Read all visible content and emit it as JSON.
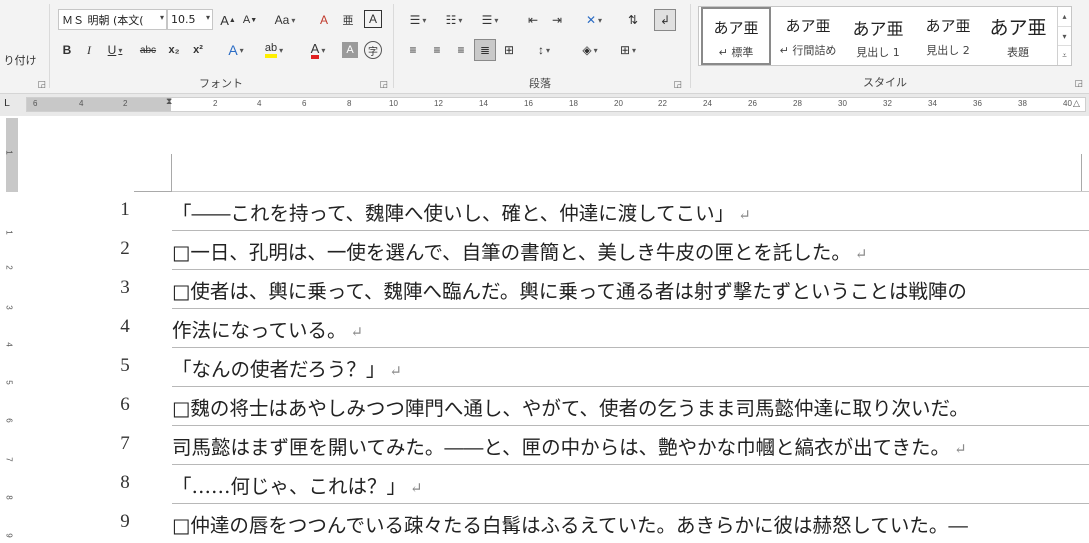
{
  "ribbon": {
    "clipboard": {
      "paste_fragment": "り付け"
    },
    "font": {
      "font_name": "ＭＳ 明朝 (本文(",
      "font_size": "10.5",
      "grow_label": "A",
      "shrink_label": "A",
      "case_label": "Aa",
      "clear_label": "A",
      "phonetic_label": "亜",
      "border_char_label": "A",
      "bold_label": "B",
      "italic_label": "I",
      "underline_label": "U",
      "strike_label": "abc",
      "sub_label": "x₂",
      "sup_label": "x²",
      "effects_label": "A",
      "highlight_label": "ab",
      "color_label": "A",
      "shade_label": "A",
      "enclose_label": "字",
      "group_label": "フォント"
    },
    "paragraph": {
      "group_label": "段落"
    },
    "styles": {
      "group_label": "スタイル",
      "items": [
        {
          "sample": "あア亜",
          "name": "↵ 標準"
        },
        {
          "sample": "あア亜",
          "name": "↵ 行間詰め"
        },
        {
          "sample": "あア亜",
          "name": "見出し 1"
        },
        {
          "sample": "あア亜",
          "name": "見出し 2"
        },
        {
          "sample": "あア亜",
          "name": "表題"
        }
      ]
    }
  },
  "ruler": {
    "corner": "L",
    "ticks": [
      "6",
      "4",
      "2",
      "2",
      "4",
      "6",
      "8",
      "10",
      "12",
      "14",
      "16",
      "18",
      "20",
      "22",
      "24",
      "26",
      "28",
      "30",
      "32",
      "34",
      "36",
      "38",
      "40"
    ],
    "vticks": [
      "1",
      "1",
      "2",
      "3",
      "4",
      "5",
      "6",
      "7",
      "8",
      "9"
    ]
  },
  "document": {
    "lines": [
      {
        "num": "1",
        "text": "「――これを持って、魏陣へ使いし、確と、仲達に渡してこい」",
        "mark": "↵"
      },
      {
        "num": "2",
        "text": "□一日、孔明は、一使を選んで、自筆の書簡と、美しき牛皮の匣とを託した。",
        "mark": "↵"
      },
      {
        "num": "3",
        "text": "□使者は、輿に乗って、魏陣へ臨んだ。輿に乗って通る者は射ず撃たずということは戦陣の",
        "mark": ""
      },
      {
        "num": "4",
        "text": "作法になっている。",
        "mark": "↵"
      },
      {
        "num": "5",
        "text": "「なんの使者だろう？」",
        "mark": "↵"
      },
      {
        "num": "6",
        "text": "□魏の将士はあやしみつつ陣門へ通し、やがて、使者の乞うまま司馬懿仲達に取り次いだ。",
        "mark": ""
      },
      {
        "num": "7",
        "text": "司馬懿はまず匣を開いてみた。――と、匣の中からは、艶やかな巾幗と縞衣が出てきた。",
        "mark": "↵"
      },
      {
        "num": "8",
        "text": "「……何じゃ、これは？」",
        "mark": "↵"
      },
      {
        "num": "9",
        "text": "□仲達の唇をつつんでいる疎々たる白髯はふるえていた。あきらかに彼は赫怒していた。―",
        "mark": ""
      }
    ]
  }
}
